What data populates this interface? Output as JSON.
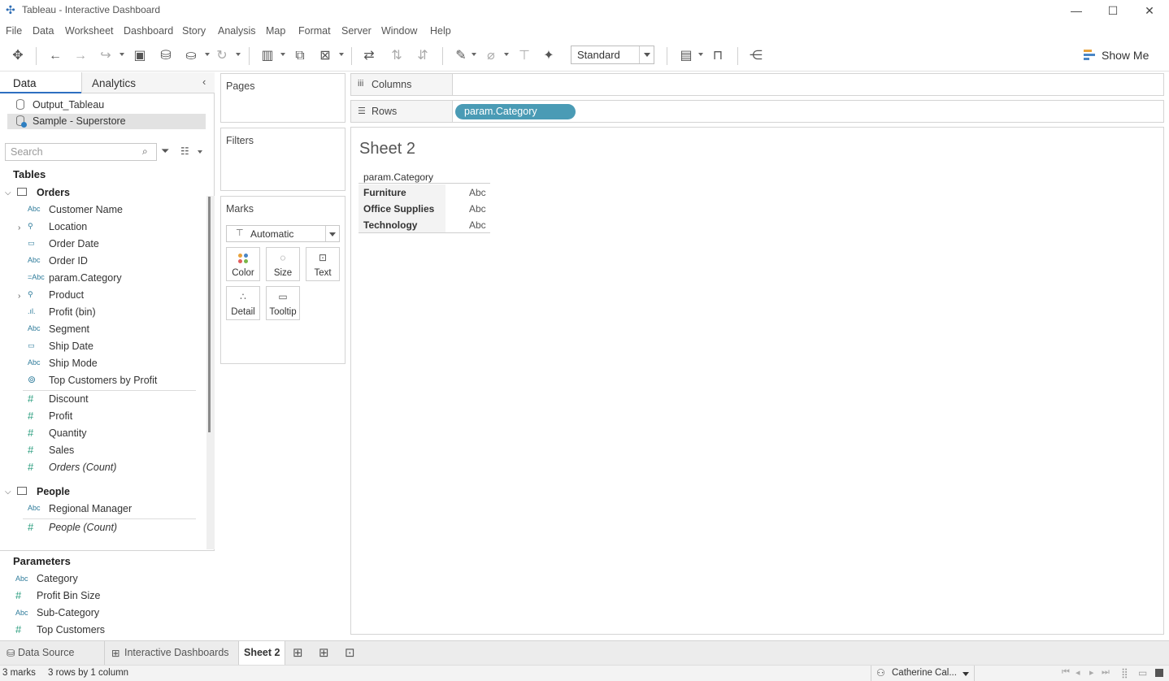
{
  "window": {
    "title": "Tableau - Interactive Dashboard",
    "minimize": "—",
    "maximize": "☐",
    "close": "✕"
  },
  "menu": [
    "File",
    "Data",
    "Worksheet",
    "Dashboard",
    "Story",
    "Analysis",
    "Map",
    "Format",
    "Server",
    "Window",
    "Help"
  ],
  "toolbar": {
    "fit_value": "Standard",
    "show_me_label": "Show Me"
  },
  "left_panel": {
    "tab_data": "Data",
    "tab_analytics": "Analytics",
    "data_sources": [
      "Output_Tableau",
      "Sample - Superstore"
    ],
    "search_placeholder": "Search",
    "tables_heading": "Tables",
    "orders": {
      "label": "Orders",
      "dimensions": [
        {
          "icon": "Abc",
          "label": "Customer Name"
        },
        {
          "icon": "hierarchy",
          "label": "Location"
        },
        {
          "icon": "calendar",
          "label": "Order Date"
        },
        {
          "icon": "Abc",
          "label": "Order ID"
        },
        {
          "icon": "=Abc",
          "label": "param.Category"
        },
        {
          "icon": "hierarchy",
          "label": "Product"
        },
        {
          "icon": "bin",
          "label": "Profit (bin)"
        },
        {
          "icon": "Abc",
          "label": "Segment"
        },
        {
          "icon": "calendar",
          "label": "Ship Date"
        },
        {
          "icon": "Abc",
          "label": "Ship Mode"
        },
        {
          "icon": "set",
          "label": "Top Customers by Profit"
        }
      ],
      "measures": [
        {
          "icon": "#",
          "label": "Discount"
        },
        {
          "icon": "#",
          "label": "Profit"
        },
        {
          "icon": "#",
          "label": "Quantity"
        },
        {
          "icon": "#",
          "label": "Sales"
        },
        {
          "icon": "#",
          "label": "Orders (Count)"
        }
      ]
    },
    "people": {
      "label": "People",
      "dimensions": [
        {
          "icon": "Abc",
          "label": "Regional Manager"
        }
      ],
      "measures": [
        {
          "icon": "#",
          "label": "People (Count)"
        }
      ]
    },
    "parameters_heading": "Parameters",
    "parameters": [
      {
        "icon": "Abc",
        "label": "Category"
      },
      {
        "icon": "#",
        "label": "Profit Bin Size"
      },
      {
        "icon": "Abc",
        "label": "Sub-Category"
      },
      {
        "icon": "#",
        "label": "Top Customers"
      }
    ]
  },
  "cards": {
    "pages": "Pages",
    "filters": "Filters",
    "marks": "Marks",
    "mark_type": "Automatic",
    "mark_buttons": [
      {
        "icon": "color-icon",
        "label": "Color"
      },
      {
        "icon": "size-icon",
        "label": "Size"
      },
      {
        "icon": "text-icon",
        "label": "Text"
      },
      {
        "icon": "detail-icon",
        "label": "Detail"
      },
      {
        "icon": "tooltip-icon",
        "label": "Tooltip"
      }
    ]
  },
  "shelves": {
    "columns_label": "Columns",
    "rows_label": "Rows",
    "rows_pill": "param.Category"
  },
  "viz": {
    "sheet_title": "Sheet 2",
    "header": "param.Category",
    "rows": [
      {
        "label": "Furniture",
        "value": "Abc"
      },
      {
        "label": "Office Supplies",
        "value": "Abc"
      },
      {
        "label": "Technology",
        "value": "Abc"
      }
    ]
  },
  "tabs": {
    "data_source": "Data Source",
    "interactive": "Interactive Dashboards",
    "sheet2": "Sheet 2"
  },
  "status": {
    "marks": "3 marks",
    "rows_cols": "3 rows by 1 column",
    "user": "Catherine Cal..."
  },
  "colors": {
    "pill": "#4a9bb5",
    "accent_tab": "#2e6fc1",
    "dimension_icon": "#2f7c9b",
    "measure_icon": "#2a9d7e"
  }
}
